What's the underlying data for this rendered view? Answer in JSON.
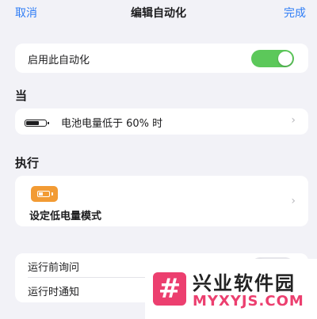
{
  "nav": {
    "cancel": "取消",
    "title": "编辑自动化",
    "done": "完成"
  },
  "enable": {
    "label": "启用此自动化",
    "on": true
  },
  "when": {
    "section_title": "当",
    "trigger_label": "电池电量低于 60% 时",
    "chevron": "›",
    "battery_level": 0.6
  },
  "do": {
    "section_title": "执行",
    "action_label": "设定低电量模式",
    "chevron": "›",
    "icon": "low-power-battery-icon"
  },
  "options": {
    "ask_before_running": "运行前询问",
    "notify_when_run": "运行时通知"
  },
  "watermark": {
    "brand_cn": "兴业软件园",
    "brand_en": "MYXYJS.COM",
    "logo_glyph": "#"
  },
  "colors": {
    "accent": "#2f7df6",
    "toggle_on": "#5cc85a",
    "action_icon": "#f29b34",
    "watermark_brand": "#ec3f6f"
  }
}
